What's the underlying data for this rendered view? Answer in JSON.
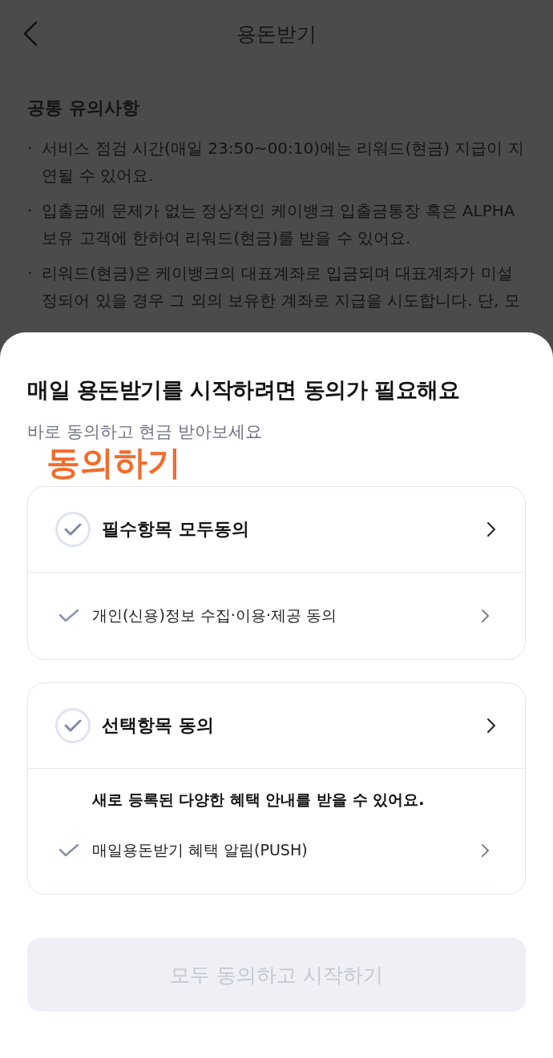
{
  "header": {
    "title": "용돈받기"
  },
  "notice": {
    "heading": "공통 유의사항",
    "bullet": "·",
    "items": [
      "서비스 점검 시간(매일 23:50~00:10)에는 리워드(현금) 지급이 지연될 수 있어요.",
      "입출금에 문제가 없는 정상적인 케이뱅크 입출금통장 혹은 ALPHA 보유 고객에 한하여 리워드(현금)를 받을 수 있어요.",
      "리워드(현금)은 케이뱅크의 대표계좌로 입금되며 대표계좌가 미설정되어 있을 경우 그 외의 보유한 계좌로 지급을 시도합니다. 단, 모"
    ]
  },
  "sheet": {
    "title": "매일 용돈받기를 시작하려면 동의가 필요해요",
    "subtitle": "바로 동의하고 현금 받아보세요",
    "annotation": "동의하기",
    "groups": [
      {
        "label": "필수항목 모두동의",
        "checked": false,
        "items": [
          {
            "label": "개인(신용)정보 수집·이용·제공 동의",
            "checked": false
          }
        ]
      },
      {
        "label": "선택항목 동의",
        "checked": false,
        "note": "새로 등록된 다양한 혜택 안내를 받을 수 있어요.",
        "items": [
          {
            "label": "매일용돈받기 혜택 알림(PUSH)",
            "checked": false
          }
        ]
      }
    ],
    "button": {
      "label": "모두 동의하고 시작하기",
      "disabled": true
    }
  }
}
